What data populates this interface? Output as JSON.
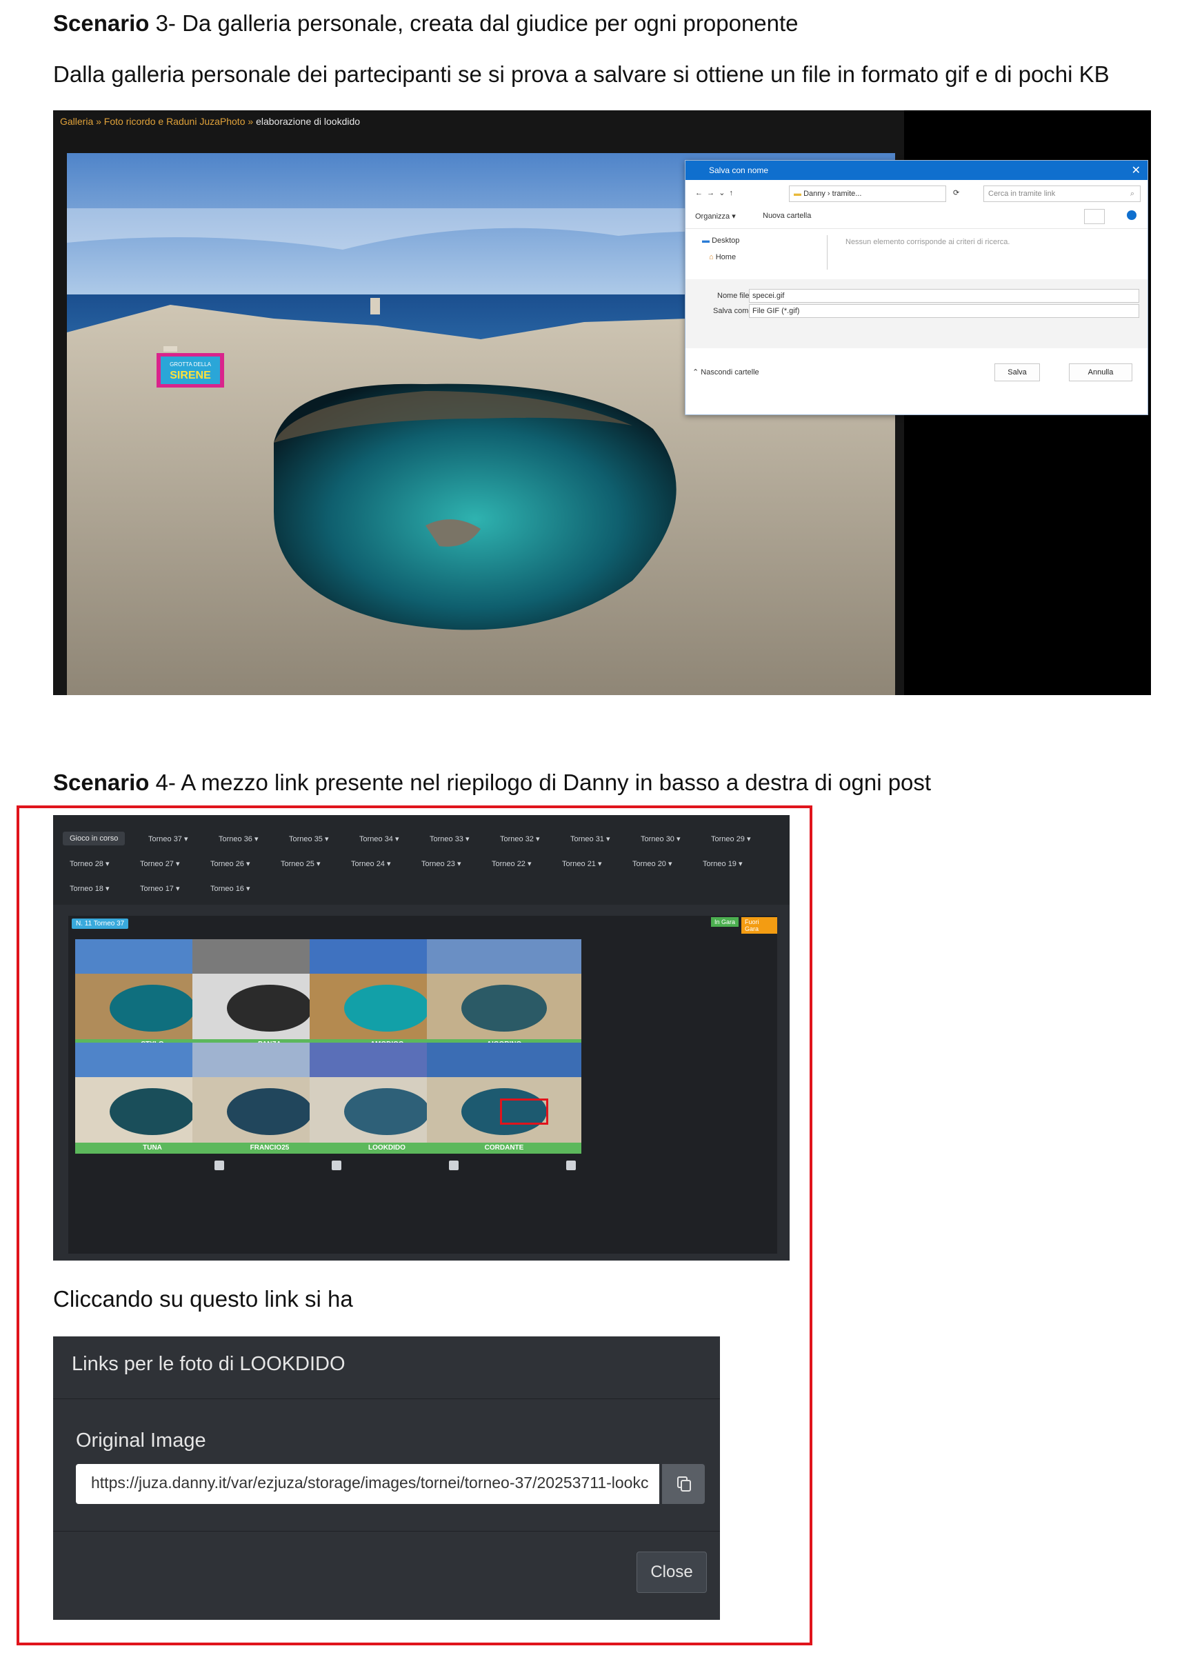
{
  "doc": {
    "s3_bold": "Scenario",
    "s3_rest": " 3- Da galleria personale, creata dal giudice per ogni proponente",
    "s3_desc": "Dalla galleria personale dei partecipanti se si prova a salvare si ottiene un file in formato gif e di pochi KB",
    "s4_bold": "Scenario",
    "s4_rest": " 4- A mezzo link presente nel riepilogo di Danny in basso a destra di ogni post",
    "click_text": "Cliccando su questo link si ha"
  },
  "shot1": {
    "breadcrumb": "Galleria » Foto ricordo e Raduni JuzaPhoto »",
    "breadcrumb_current": "elaborazione di lookdido",
    "sign_line1": "GROTTA DELLA",
    "sign_line2": "SIRENE",
    "dialog": {
      "title": "Salva con nome",
      "path": "Danny › tramite...",
      "search_placeholder": "Cerca in tramite link",
      "organize": "Organizza ▾",
      "new_folder": "Nuova cartella",
      "tree": [
        "Desktop",
        "Home"
      ],
      "empty_msg": "Nessun elemento corrisponde ai criteri di ricerca.",
      "filename_label": "Nome file:",
      "filename_value": "specei.gif",
      "type_label": "Salva come:",
      "type_value": "File GIF (*.gif)",
      "hide_folders": "Nascondi cartelle",
      "save": "Salva",
      "cancel": "Annulla"
    }
  },
  "shot2": {
    "tabs_row1": [
      "Gioco in corso",
      "Torneo 37 ▾",
      "Torneo 36 ▾",
      "Torneo 35 ▾",
      "Torneo 34 ▾",
      "Torneo 33 ▾",
      "Torneo 32 ▾",
      "Torneo 31 ▾",
      "Torneo 30 ▾",
      "Torneo 29 ▾"
    ],
    "tabs_row2": [
      "Torneo 28 ▾",
      "Torneo 27 ▾",
      "Torneo 26 ▾",
      "Torneo 25 ▾",
      "Torneo 24 ▾",
      "Torneo 23 ▾",
      "Torneo 22 ▾",
      "Torneo 21 ▾",
      "Torneo 20 ▾",
      "Torneo 19 ▾"
    ],
    "tabs_row3": [
      "Torneo 18 ▾",
      "Torneo 17 ▾",
      "Torneo 16 ▾"
    ],
    "badge": "N. 11 Torneo 37",
    "badge_green": "In Gara",
    "badge_orange": "Fuori Gara",
    "entries": [
      "STYLO",
      "PANZA",
      "AMODIOC",
      "AIGORINO",
      "TUNA",
      "FRANCIO25",
      "LOOKDIDO",
      "CORDANTE"
    ]
  },
  "modal": {
    "title": "Links per le foto di LOOKDIDO",
    "label": "Original Image",
    "url": "https://juza.danny.it/var/ezjuza/storage/images/tornei/torneo-37/20253711-lookc",
    "close": "Close"
  }
}
